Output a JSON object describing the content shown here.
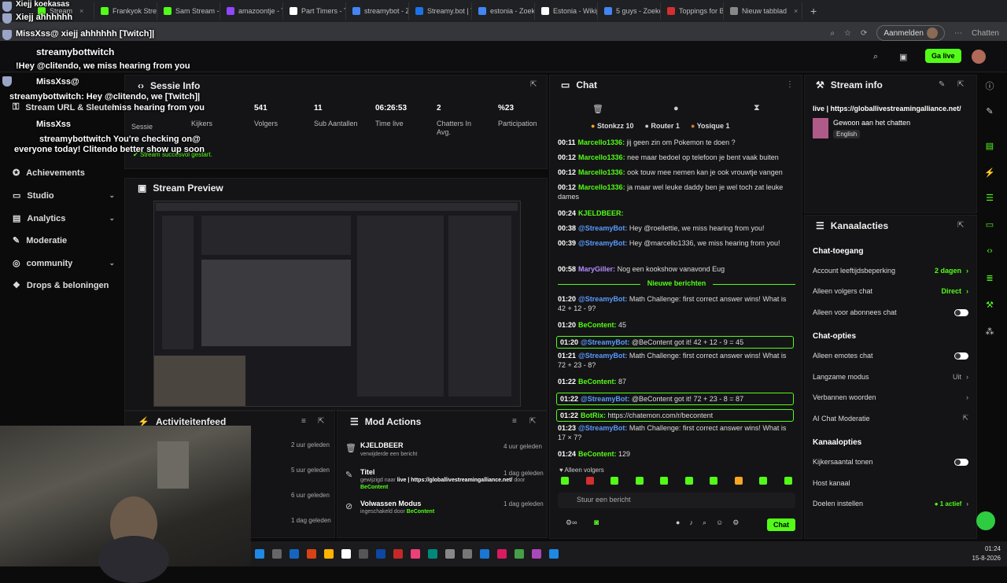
{
  "browser": {
    "tabs": [
      {
        "label": "Stream",
        "color": "#53fc18"
      },
      {
        "label": "Frankyok Strea",
        "color": "#53fc18"
      },
      {
        "label": "Sam Stream - W",
        "color": "#53fc18"
      },
      {
        "label": "amazoontje - Tr",
        "color": "#9146ff"
      },
      {
        "label": "Part Timers - T",
        "color": "#ffffff"
      },
      {
        "label": "streamybot - Zo",
        "color": "#4285f4"
      },
      {
        "label": "Streamy.bot | T",
        "color": "#1a73e8"
      },
      {
        "label": "estonia - Zoeke",
        "color": "#4285f4"
      },
      {
        "label": "Estonia - Wikip",
        "color": "#ffffff"
      },
      {
        "label": "5 guys - Zoeke",
        "color": "#4285f4"
      },
      {
        "label": "Toppings for Bu",
        "color": "#d32f2f"
      },
      {
        "label": "Nieuw tabblad",
        "color": "#888888"
      }
    ],
    "signin_label": "Aanmelden",
    "chatten_label": "Chatten"
  },
  "overlay": {
    "lines": [
      {
        "user": "Xiejj",
        "text": "Xiejj koekasas"
      },
      {
        "user": "Xiejj",
        "text": "Xiejj ahhhhhh"
      },
      {
        "user": "MissXss",
        "text": "MissXss@ xiejj ahhhhhh [Twitch]|"
      },
      {
        "user": "streamybottwitch",
        "text": "streamybottwitch"
      },
      {
        "user": "",
        "text": "!Hey @clitendo, we miss hearing from you"
      },
      {
        "user": "MissXss",
        "text": "MissXss@"
      },
      {
        "user": "",
        "text": "streamybottwitch: Hey @clitendo, we [Twitch]|"
      },
      {
        "user": "",
        "text": "miss hearing from you"
      },
      {
        "user": "MissXss",
        "text": "MissXss"
      },
      {
        "user": "",
        "text": "streamybottwitch You're checking on@"
      },
      {
        "user": "",
        "text": "everyone today! Clitendo better show up soon"
      }
    ]
  },
  "sidebar": {
    "items": [
      {
        "label": "Stream URL & Sleutel",
        "chevron": false
      },
      {
        "label": "Achievements",
        "chevron": false
      },
      {
        "label": "Studio",
        "chevron": true
      },
      {
        "label": "Analytics",
        "chevron": true
      },
      {
        "label": "Moderatie",
        "chevron": false
      },
      {
        "label": "community",
        "chevron": true
      },
      {
        "label": "Drops & beloningen",
        "chevron": false
      }
    ]
  },
  "sessie": {
    "title": "Sessie Info",
    "side_label": "Sessie",
    "kijkers_label": "Kijkers",
    "status": "Stream succesvol gestart.",
    "stats": [
      {
        "value": "541",
        "label": "Volgers"
      },
      {
        "value": "11",
        "label": "Sub Aantallen"
      },
      {
        "value": "06:26:53",
        "label": "Time live"
      },
      {
        "value": "2",
        "label": "Chatters In Avg."
      },
      {
        "value": "%23",
        "label": "Participation"
      }
    ]
  },
  "preview": {
    "title": "Stream Preview"
  },
  "activity": {
    "title": "Activiteitenfeed",
    "items": [
      "2 uur geleden",
      "5 uur geleden",
      "6 uur geleden",
      "1 dag geleden"
    ]
  },
  "modactions": {
    "title": "Mod Actions",
    "items": [
      {
        "title": "KJELDBEER",
        "sub": "verwijderde een bericht",
        "ago": "4 uur geleden"
      },
      {
        "title": "Titel",
        "sub_prefix": "gewijzigd naar",
        "sub_value": "live | https://globallivestreamingalliance.net/",
        "sub_mid": "door",
        "sub_user": "BeContent",
        "ago": "1 dag geleden"
      },
      {
        "title": "Volwassen Modus",
        "sub_prefix": "ingeschakeld door",
        "sub_user": "BeContent",
        "ago": "1 dag geleden"
      }
    ]
  },
  "chat": {
    "title": "Chat",
    "pinned": [
      "Stonkzz 10",
      "Router 1",
      "Yosique 1"
    ],
    "messages": [
      {
        "time": "00:11",
        "user": "Marcello1336:",
        "text": "jij geen zin om Pokemon te doen ?",
        "color": "#53fc18"
      },
      {
        "time": "00:12",
        "user": "Marcello1336:",
        "text": "nee maar bedoel op telefoon je bent vaak buiten",
        "color": "#53fc18"
      },
      {
        "time": "00:12",
        "user": "Marcello1336:",
        "text": "ook touw mee nemen kan je ook vrouwtje vangen",
        "color": "#53fc18"
      },
      {
        "time": "00:12",
        "user": "Marcello1336:",
        "text": "ja maar wel leuke daddy ben je wel toch zat leuke dames",
        "color": "#53fc18"
      },
      {
        "time": "00:24",
        "user": "KJELDBEER:",
        "text": "",
        "color": "#53fc18"
      },
      {
        "time": "00:38",
        "user": "@StreamyBot:",
        "text": "Hey @roellettie, we miss hearing from you!",
        "color": "#5a9bff"
      },
      {
        "time": "00:39",
        "user": "@StreamyBot:",
        "text": "Hey @marcello1336, we miss hearing from you!",
        "color": "#5a9bff"
      },
      {
        "time": "00:58",
        "user": "MaryGiller:",
        "text": "Nog een kookshow vanavond Eug",
        "color": "#b48cff"
      }
    ],
    "new_label": "Nieuwe berichten",
    "messages2": [
      {
        "time": "01:20",
        "user": "@StreamyBot:",
        "text": "Math Challenge: first correct answer wins! What is 42 + 12 - 9?",
        "color": "#5a9bff",
        "hl": false
      },
      {
        "time": "01:20",
        "user": "BeContent:",
        "text": "45",
        "color": "#53fc18",
        "hl": false
      },
      {
        "time": "01:20",
        "user": "@StreamyBot:",
        "text": "@BeContent got it! 42 + 12 - 9 = 45",
        "color": "#5a9bff",
        "hl": true
      },
      {
        "time": "01:21",
        "user": "@StreamyBot:",
        "text": "Math Challenge: first correct answer wins! What is 72 + 23 - 8?",
        "color": "#5a9bff",
        "hl": false
      },
      {
        "time": "01:22",
        "user": "BeContent:",
        "text": "87",
        "color": "#53fc18",
        "hl": false
      },
      {
        "time": "01:22",
        "user": "@StreamyBot:",
        "text": "@BeContent got it! 72 + 23 - 8 = 87",
        "color": "#5a9bff",
        "hl": true
      },
      {
        "time": "01:22",
        "user": "BotRix:",
        "text": "https://chatemon.com/r/becontent",
        "color": "#53fc18",
        "hl": true
      },
      {
        "time": "01:23",
        "user": "@StreamyBot:",
        "text": "Math Challenge: first correct answer wins! What is 17 × 7?",
        "color": "#5a9bff",
        "hl": false
      },
      {
        "time": "01:24",
        "user": "BeContent:",
        "text": "129",
        "color": "#53fc18",
        "hl": false
      }
    ],
    "followers_only": "Alleen volgers",
    "input_placeholder": "Stuur een bericht",
    "send_label": "Chat"
  },
  "streaminfo": {
    "title": "Stream info",
    "stream_title": "live | https://globallivestreamingalliance.net/",
    "category": "Gewoon aan het chatten",
    "language": "English"
  },
  "kanaal": {
    "title": "Kanaalacties",
    "h1": "Chat-toegang",
    "age_label": "Account leeftijdsbeperking",
    "age_value": "2 dagen",
    "followers_label": "Alleen volgers chat",
    "followers_value": "Direct",
    "subs_label": "Alleen voor abonnees chat",
    "h2": "Chat-opties",
    "emotes_label": "Alleen emotes chat",
    "slow_label": "Langzame modus",
    "slow_value": "Uit",
    "banned_label": "Verbannen woorden",
    "ai_label": "AI Chat Moderatie",
    "h3": "Kanaalopties",
    "viewers_label": "Kijkersaantal tonen",
    "host_label": "Host kanaal",
    "goals_label": "Doelen instellen",
    "goals_value": "1 actief"
  },
  "nav": {
    "golive_label": "Ga live"
  },
  "taskbar": {
    "time": "01:24",
    "date": "15-8-2026"
  }
}
